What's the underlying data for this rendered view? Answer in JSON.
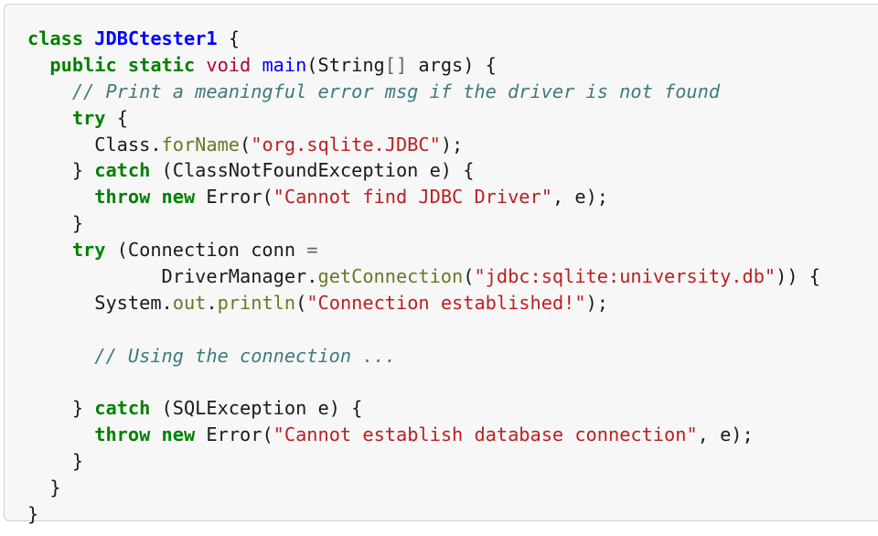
{
  "lines": [
    [
      {
        "t": "class",
        "c": "kw"
      },
      {
        "t": " "
      },
      {
        "t": "JDBCtester1",
        "c": "cls"
      },
      {
        "t": " {"
      }
    ],
    [
      {
        "t": "  "
      },
      {
        "t": "public",
        "c": "kw"
      },
      {
        "t": " "
      },
      {
        "t": "static",
        "c": "kw"
      },
      {
        "t": " "
      },
      {
        "t": "void",
        "c": "ty"
      },
      {
        "t": " "
      },
      {
        "t": "main",
        "c": "fn"
      },
      {
        "t": "(String"
      },
      {
        "t": "[]",
        "c": "op"
      },
      {
        "t": " args) {"
      }
    ],
    [
      {
        "t": "    "
      },
      {
        "t": "// Print a meaningful error msg if the driver is not found",
        "c": "cm"
      }
    ],
    [
      {
        "t": "    "
      },
      {
        "t": "try",
        "c": "kw"
      },
      {
        "t": " {"
      }
    ],
    [
      {
        "t": "      Class."
      },
      {
        "t": "forName",
        "c": "mt"
      },
      {
        "t": "("
      },
      {
        "t": "\"org.sqlite.JDBC\"",
        "c": "st"
      },
      {
        "t": ");"
      }
    ],
    [
      {
        "t": "    } "
      },
      {
        "t": "catch",
        "c": "kw"
      },
      {
        "t": " (ClassNotFoundException e) {"
      }
    ],
    [
      {
        "t": "      "
      },
      {
        "t": "throw",
        "c": "kw"
      },
      {
        "t": " "
      },
      {
        "t": "new",
        "c": "kw"
      },
      {
        "t": " Error("
      },
      {
        "t": "\"Cannot find JDBC Driver\"",
        "c": "st"
      },
      {
        "t": ", e);"
      }
    ],
    [
      {
        "t": "    }"
      }
    ],
    [
      {
        "t": "    "
      },
      {
        "t": "try",
        "c": "kw"
      },
      {
        "t": " (Connection conn "
      },
      {
        "t": "=",
        "c": "op"
      }
    ],
    [
      {
        "t": "            DriverManager."
      },
      {
        "t": "getConnection",
        "c": "mt"
      },
      {
        "t": "("
      },
      {
        "t": "\"jdbc:sqlite:university.db\"",
        "c": "st"
      },
      {
        "t": ")) {"
      }
    ],
    [
      {
        "t": "      System."
      },
      {
        "t": "out",
        "c": "mt"
      },
      {
        "t": "."
      },
      {
        "t": "println",
        "c": "mt"
      },
      {
        "t": "("
      },
      {
        "t": "\"Connection established!\"",
        "c": "st"
      },
      {
        "t": ");"
      }
    ],
    [
      {
        "t": ""
      }
    ],
    [
      {
        "t": "      "
      },
      {
        "t": "// Using the connection ...",
        "c": "cm"
      }
    ],
    [
      {
        "t": ""
      }
    ],
    [
      {
        "t": "    } "
      },
      {
        "t": "catch",
        "c": "kw"
      },
      {
        "t": " (SQLException e) {"
      }
    ],
    [
      {
        "t": "      "
      },
      {
        "t": "throw",
        "c": "kw"
      },
      {
        "t": " "
      },
      {
        "t": "new",
        "c": "kw"
      },
      {
        "t": " Error("
      },
      {
        "t": "\"Cannot establish database connection\"",
        "c": "st"
      },
      {
        "t": ", e);"
      }
    ],
    [
      {
        "t": "    }"
      }
    ],
    [
      {
        "t": "  }"
      }
    ],
    [
      {
        "t": "}"
      }
    ]
  ]
}
